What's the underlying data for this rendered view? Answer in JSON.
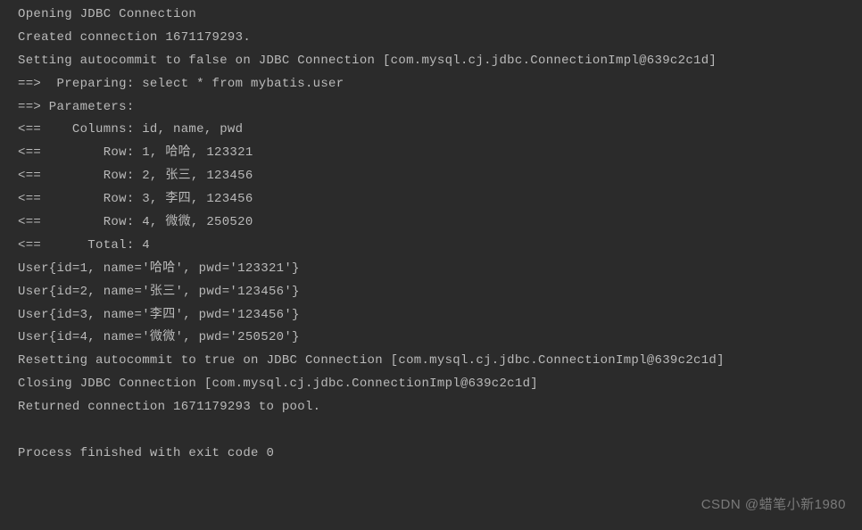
{
  "lines": [
    "Opening JDBC Connection",
    "Created connection 1671179293.",
    "Setting autocommit to false on JDBC Connection [com.mysql.cj.jdbc.ConnectionImpl@639c2c1d]",
    "==>  Preparing: select * from mybatis.user",
    "==> Parameters: ",
    "<==    Columns: id, name, pwd",
    "<==        Row: 1, 哈哈, 123321",
    "<==        Row: 2, 张三, 123456",
    "<==        Row: 3, 李四, 123456",
    "<==        Row: 4, 微微, 250520",
    "<==      Total: 4",
    "User{id=1, name='哈哈', pwd='123321'}",
    "User{id=2, name='张三', pwd='123456'}",
    "User{id=3, name='李四', pwd='123456'}",
    "User{id=4, name='微微', pwd='250520'}",
    "Resetting autocommit to true on JDBC Connection [com.mysql.cj.jdbc.ConnectionImpl@639c2c1d]",
    "Closing JDBC Connection [com.mysql.cj.jdbc.ConnectionImpl@639c2c1d]",
    "Returned connection 1671179293 to pool."
  ],
  "finalLine": "Process finished with exit code 0",
  "watermark": "CSDN @蜡笔小新1980"
}
